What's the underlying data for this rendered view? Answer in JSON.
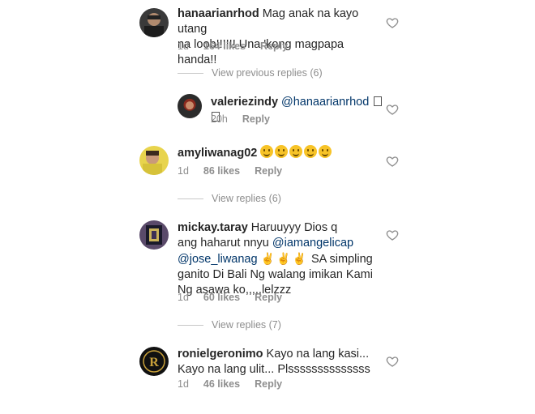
{
  "comments": [
    {
      "username": "hanaarianrhod",
      "text_line1": "Mag anak na kayo utang",
      "text_line2": "na loob!!!!!! Una 'kong magpapa handa!!",
      "time": "1d",
      "likes": "164 likes",
      "reply": "Reply",
      "view_replies": "View previous replies (6)"
    },
    {
      "username": "valeriezindy",
      "mention": "@hanaarianrhod",
      "trailing": " ",
      "time": "20h",
      "reply": "Reply"
    },
    {
      "username": "amyliwanag02",
      "emoji_name": "smiling-face-emoji",
      "emoji_count": 5,
      "time": "1d",
      "likes": "86 likes",
      "reply": "Reply",
      "view_replies": "View replies (6)"
    },
    {
      "username": "mickay.taray",
      "text_line1": "Haruuyyy Dios q",
      "text_line2a": "ang haharut nnyu ",
      "mention1": "@iamangelicap",
      "mention2": "@jose_liwanag",
      "text_line3b": "SA simpling",
      "text_line4": "ganito Di Bali Ng walang imikan Kami",
      "text_line5": "Ng asawa ko,,,,,lelzzz",
      "time": "1d",
      "likes": "60 likes",
      "reply": "Reply",
      "view_replies": "View replies (7)"
    },
    {
      "username": "ronielgeronimo",
      "text_line1": "Kayo na lang kasi...",
      "text_line2": "Kayo na lang ulit... Plssssssssssssss",
      "time": "1d",
      "likes": "46 likes",
      "reply": "Reply"
    }
  ],
  "colors": {
    "text": "#262626",
    "muted": "#8e8e8e",
    "mention": "#003569",
    "divider": "#c7c7c7"
  },
  "icons": {
    "like": "heart-outline-icon",
    "victory": "victory-hand-emoji"
  }
}
